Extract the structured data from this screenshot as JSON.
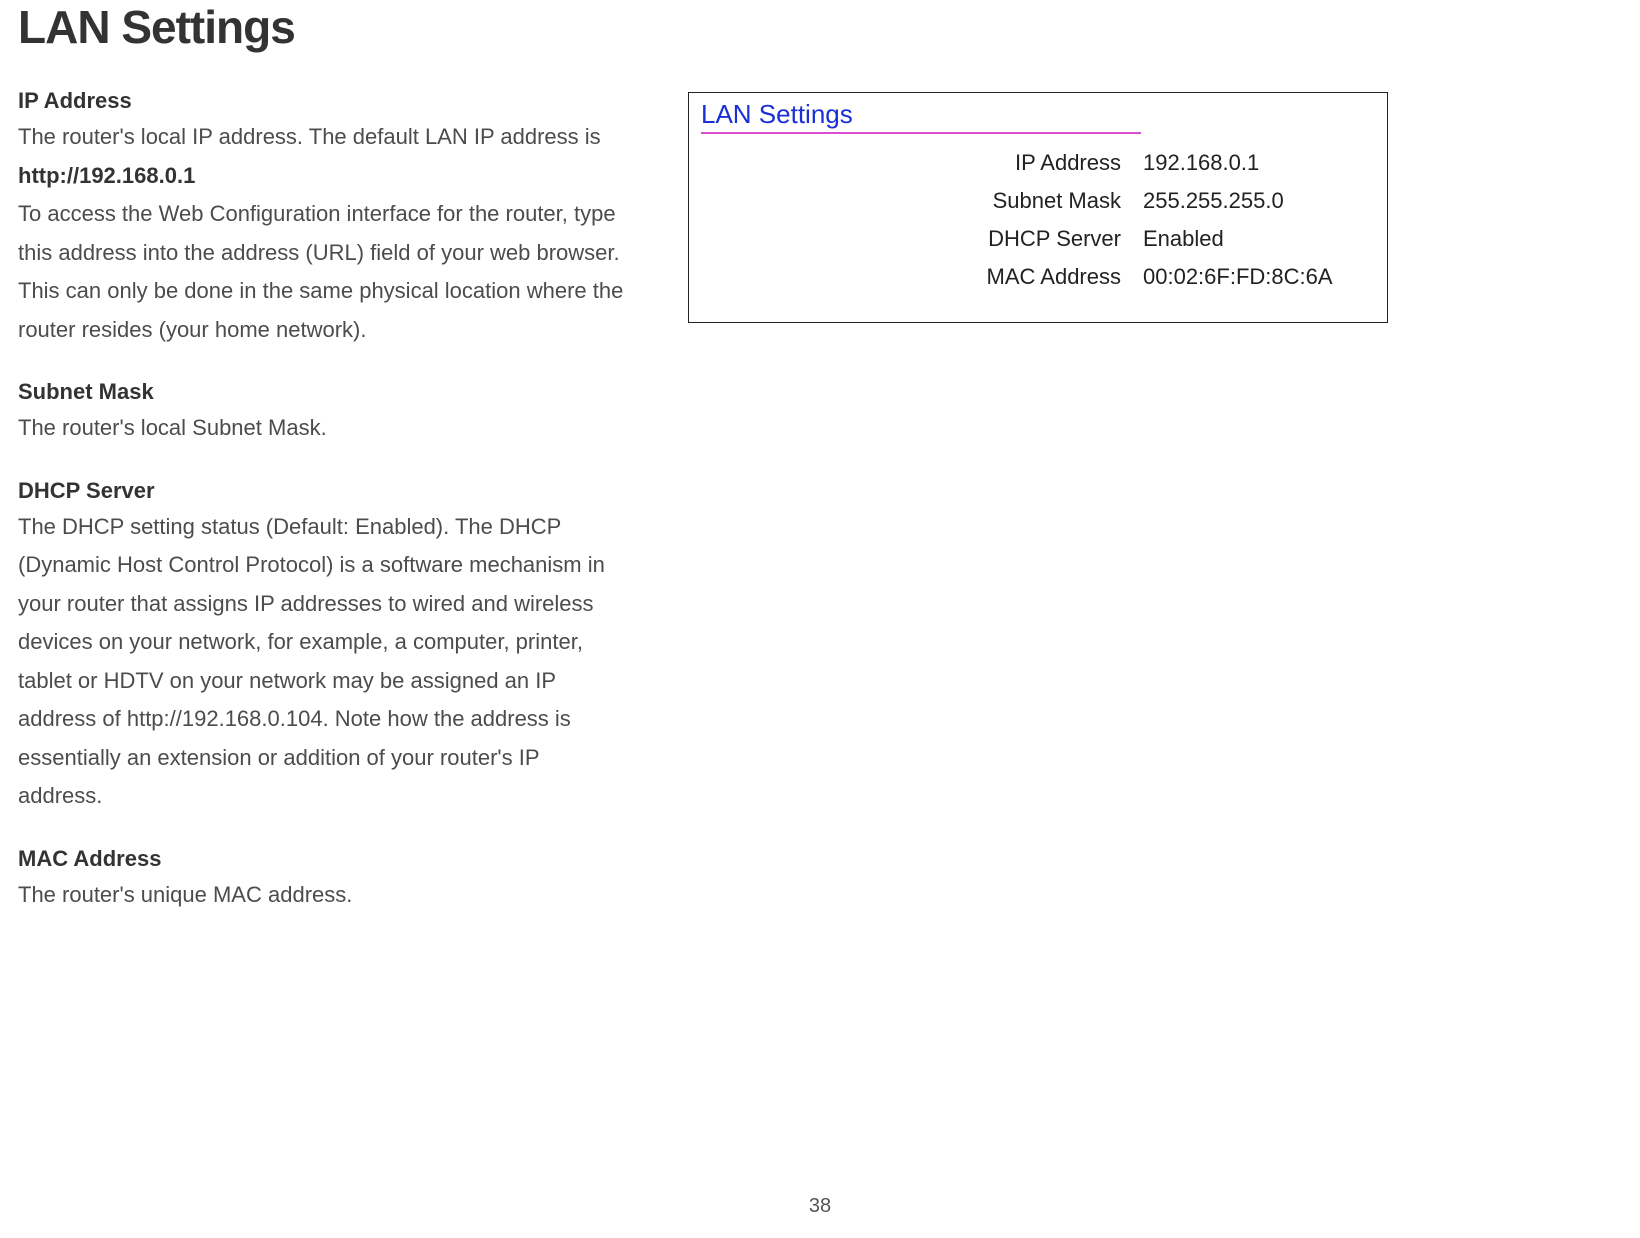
{
  "title": "LAN Settings",
  "page_number": "38",
  "sections": {
    "ip_address": {
      "heading": "IP Address",
      "body_part1": "The router's local IP address. The default LAN IP address is ",
      "default_ip": "http://192.168.0.1",
      "body_part2": "To access the Web Configuration interface for the router, type this address into the address (URL) field of your web browser. This can only be done in the same physical location where the router resides (your home network)."
    },
    "subnet_mask": {
      "heading": "Subnet Mask",
      "body": "The router's local Subnet Mask."
    },
    "dhcp_server": {
      "heading": "DHCP Server",
      "body": "The DHCP setting status (Default: Enabled). The DHCP (Dynamic Host Control Protocol) is a software mechanism in your router that assigns IP addresses to wired and wireless devices on your network, for example, a computer, printer, tablet or HDTV on your network may be assigned an IP address of http://192.168.0.104. Note how the address is essentially an extension or addition of your router's IP address."
    },
    "mac_address": {
      "heading": "MAC Address",
      "body": "The router's unique MAC address."
    }
  },
  "panel": {
    "title": "LAN Settings",
    "rows": {
      "ip_address": {
        "label": "IP Address",
        "value": "192.168.0.1"
      },
      "subnet_mask": {
        "label": "Subnet Mask",
        "value": "255.255.255.0"
      },
      "dhcp_server": {
        "label": "DHCP Server",
        "value": "Enabled"
      },
      "mac_address": {
        "label": "MAC Address",
        "value": "00:02:6F:FD:8C:6A"
      }
    }
  }
}
